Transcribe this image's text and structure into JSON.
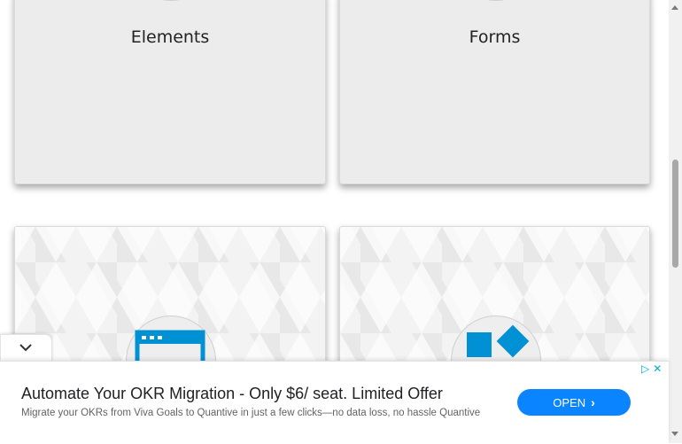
{
  "cards": [
    {
      "title": "Elements"
    },
    {
      "title": "Forms"
    },
    {
      "title": ""
    },
    {
      "title": ""
    }
  ],
  "icons": {
    "card3": "browser-window-icon",
    "card4": "widgets-icon"
  },
  "colors": {
    "accent": "#0091d5",
    "card_bg": "#ececec",
    "ad_button": "#0b84ff"
  },
  "ad": {
    "headline": "Automate Your OKR Migration - Only $6/ seat. Limited Offer",
    "description": "Migrate your OKRs from Viva Goals to Quantive in just a few clicks—no data loss, no hassle Quantive",
    "button_label": "OPEN",
    "button_chevron": "›",
    "adchoices_icon": "▷",
    "close_icon": "✕",
    "collapse_icon": "chevron-down-icon"
  }
}
